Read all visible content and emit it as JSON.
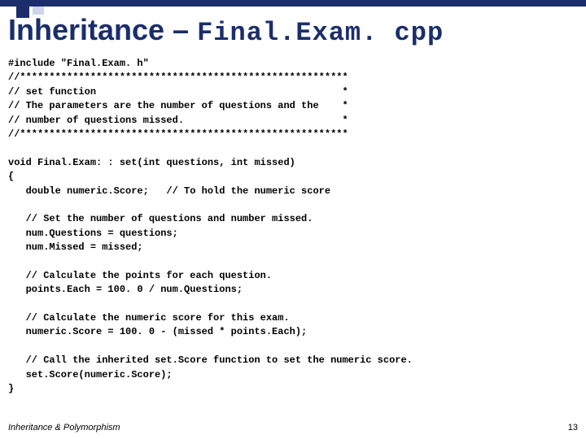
{
  "title": {
    "part1": "Inheritance – ",
    "part2": "Final.Exam. cpp"
  },
  "code": {
    "l01": "#include \"Final.Exam. h\"",
    "l02": "//********************************************************",
    "l03": "// set function                                          *",
    "l04": "// The parameters are the number of questions and the    *",
    "l05": "// number of questions missed.                           *",
    "l06": "//********************************************************",
    "l07": "",
    "l08": "void Final.Exam: : set(int questions, int missed)",
    "l09": "{",
    "l10": "   double numeric.Score;   // To hold the numeric score",
    "l11": "",
    "l12": "   // Set the number of questions and number missed.",
    "l13": "   num.Questions = questions;",
    "l14": "   num.Missed = missed;",
    "l15": "",
    "l16": "   // Calculate the points for each question.",
    "l17": "   points.Each = 100. 0 / num.Questions;",
    "l18": "",
    "l19": "   // Calculate the numeric score for this exam.",
    "l20": "   numeric.Score = 100. 0 - (missed * points.Each);",
    "l21": "",
    "l22": "   // Call the inherited set.Score function to set the numeric score.",
    "l23": "   set.Score(numeric.Score);",
    "l24": "}"
  },
  "footer": {
    "left": "Inheritance & Polymorphism",
    "right": "13"
  }
}
